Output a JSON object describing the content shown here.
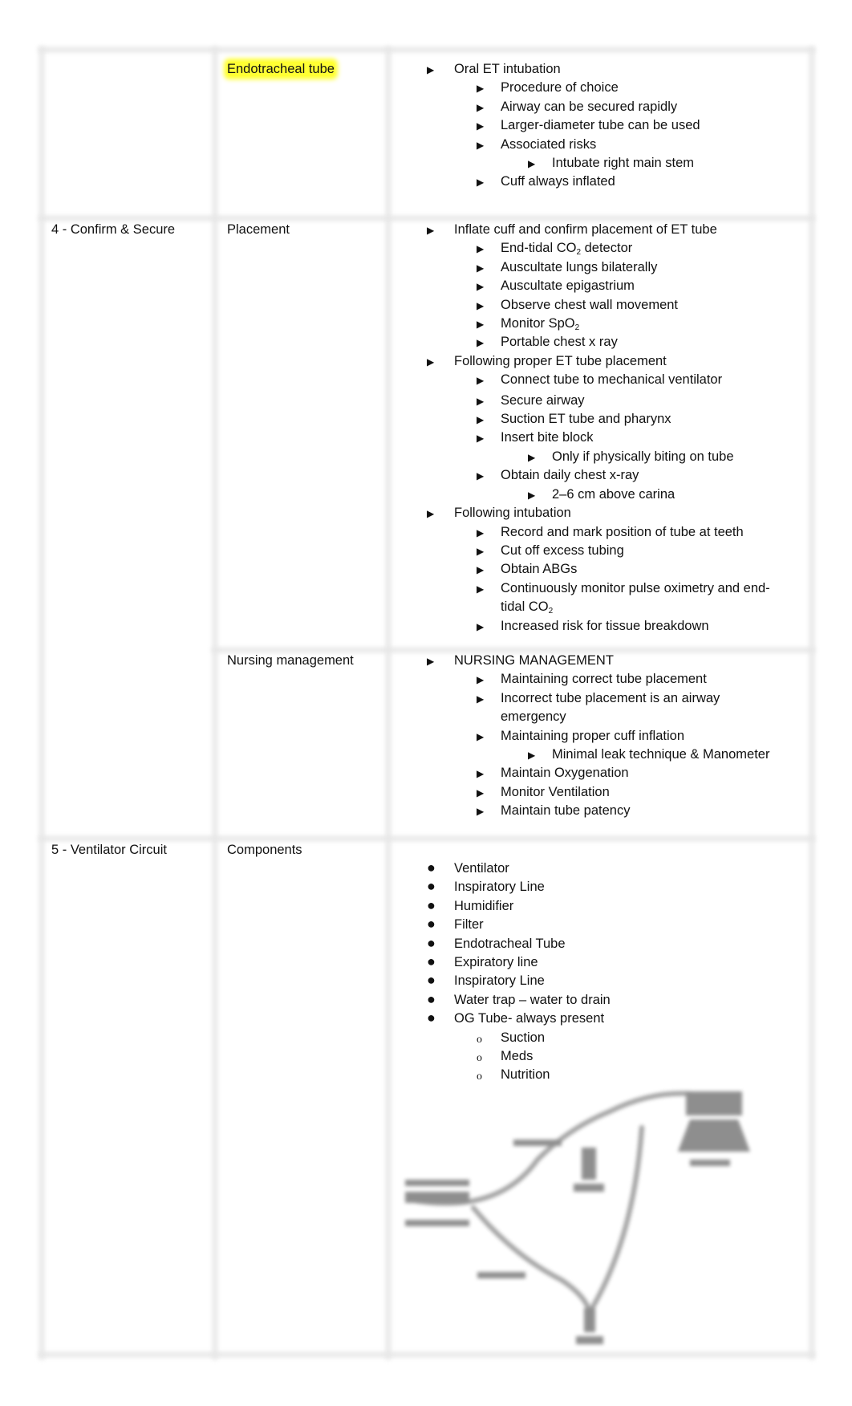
{
  "table": {
    "rows": [
      {
        "section": "",
        "topic": "Endotracheal tube",
        "topic_highlighted": true,
        "highlight_color": "#ffff33",
        "items": [
          {
            "level": 1,
            "text": "Oral ET intubation"
          },
          {
            "level": 2,
            "text": "Procedure of choice"
          },
          {
            "level": 2,
            "text": "Airway can be secured rapidly"
          },
          {
            "level": 2,
            "text": "Larger-diameter tube can be used"
          },
          {
            "level": 2,
            "text": "Associated risks"
          },
          {
            "level": 3,
            "text": "Intubate right main stem"
          },
          {
            "level": 2,
            "text": "Cuff always inflated"
          }
        ]
      },
      {
        "section": "4 - Confirm & Secure",
        "topic": "Placement",
        "items": [
          {
            "level": 1,
            "text": "Inflate cuff and confirm placement of ET tube"
          },
          {
            "level": 2,
            "text": "End-tidal CO",
            "sub": "2",
            "after": " detector"
          },
          {
            "level": 2,
            "text": "Auscultate lungs bilaterally"
          },
          {
            "level": 2,
            "text": "Auscultate epigastrium"
          },
          {
            "level": 2,
            "text": "Observe chest wall movement"
          },
          {
            "level": 2,
            "text": "Monitor SpO",
            "sub": "2",
            "after": ""
          },
          {
            "level": 2,
            "text": "Portable chest x ray"
          },
          {
            "level": 1,
            "text": "Following proper ET tube placement"
          },
          {
            "level": 2,
            "text": "Connect tube to mechanical ventilator"
          },
          {
            "level": 2,
            "text": "Secure airway"
          },
          {
            "level": 2,
            "text": "Suction ET tube and pharynx"
          },
          {
            "level": 2,
            "text": "Insert bite block"
          },
          {
            "level": 3,
            "text": "Only if physically biting on tube"
          },
          {
            "level": 2,
            "text": "Obtain daily chest x-ray"
          },
          {
            "level": 3,
            "text": "2–6 cm above carina"
          },
          {
            "level": 1,
            "text": "Following intubation"
          },
          {
            "level": 2,
            "text": "Record and mark position of tube at teeth"
          },
          {
            "level": 2,
            "text": "Cut off excess tubing"
          },
          {
            "level": 2,
            "text": "Obtain ABGs"
          },
          {
            "level": 2,
            "text": "Continuously monitor pulse oximetry and end-tidal CO",
            "sub": "2",
            "after": ""
          },
          {
            "level": 2,
            "text": "Increased risk for tissue breakdown"
          }
        ]
      },
      {
        "section": "",
        "topic": "Nursing management",
        "items": [
          {
            "level": 1,
            "text": "NURSING MANAGEMENT"
          },
          {
            "level": 2,
            "text": "Maintaining correct tube placement"
          },
          {
            "level": 2,
            "text": "Incorrect tube placement is an airway emergency"
          },
          {
            "level": 2,
            "text": "Maintaining proper cuff inflation"
          },
          {
            "level": 3,
            "text": "Minimal leak technique & Manometer"
          },
          {
            "level": 2,
            "text": "Maintain Oxygenation"
          },
          {
            "level": 2,
            "text": "Monitor Ventilation"
          },
          {
            "level": 2,
            "text": "Maintain tube patency"
          }
        ]
      },
      {
        "section": "5 - Ventilator Circuit",
        "topic": "Components",
        "items": [
          {
            "level": 1,
            "text": "Ventilator"
          },
          {
            "level": 1,
            "text": "Inspiratory Line"
          },
          {
            "level": 1,
            "text": "Humidifier"
          },
          {
            "level": 1,
            "text": "Filter"
          },
          {
            "level": 1,
            "text": "Endotracheal Tube"
          },
          {
            "level": 1,
            "text": "Expiratory line"
          },
          {
            "level": 1,
            "text": "Inspiratory Line"
          },
          {
            "level": 1,
            "text": "Water trap – water to drain"
          },
          {
            "level": 1,
            "text": "OG Tube- always present"
          },
          {
            "level": 2,
            "text": "Suction"
          },
          {
            "level": 2,
            "text": "Meds"
          },
          {
            "level": 2,
            "text": "Nutrition"
          }
        ],
        "figure": "ventilator-circuit-diagram"
      }
    ]
  },
  "icons": {
    "arrow_bullet": "▶",
    "dot_bullet": "●",
    "circle_bullet": "o"
  }
}
